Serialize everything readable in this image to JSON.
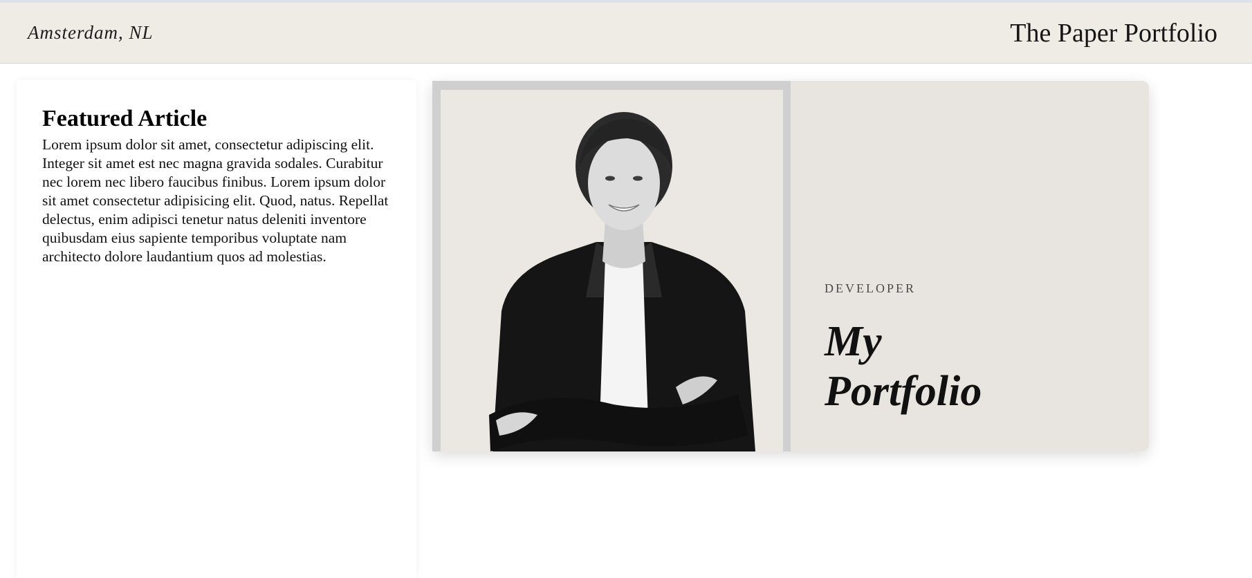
{
  "header": {
    "location": "Amsterdam, NL",
    "site_title": "The Paper Portfolio"
  },
  "article": {
    "title": "Featured Article",
    "body": "Lorem ipsum dolor sit amet, consectetur adipiscing elit. Integer sit amet est nec magna gravida sodales. Curabitur nec lorem nec libero faucibus finibus. Lorem ipsum dolor sit amet consectetur adipisicing elit. Quod, natus. Repellat delectus, enim adipisci tenetur natus deleniti inventore quibusdam eius sapiente temporibus voluptate nam architecto dolore laudantium quos ad molestias."
  },
  "hero": {
    "role": "DEVELOPER",
    "title": "My Portfolio",
    "photo_alt": "Smiling woman in a dark blazer with arms crossed"
  },
  "colors": {
    "header_bg": "#efebe5",
    "card_bg": "#e8e5e0",
    "frame": "#cfcfcf"
  }
}
